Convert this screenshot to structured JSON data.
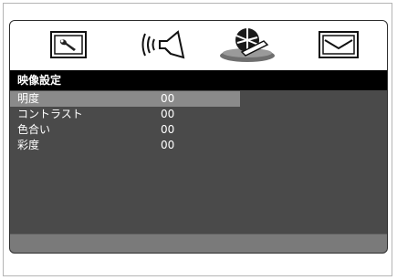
{
  "title": "映像設定",
  "tabs": [
    {
      "icon": "system-setup-icon"
    },
    {
      "icon": "audio-icon"
    },
    {
      "icon": "video-icon"
    },
    {
      "icon": "preferences-icon"
    }
  ],
  "items": [
    {
      "label": "明度",
      "value": "00"
    },
    {
      "label": "コントラスト",
      "value": "00"
    },
    {
      "label": "色合い",
      "value": "00"
    },
    {
      "label": "彩度",
      "value": "00"
    }
  ],
  "colors": {
    "osd_background": "#4a4a4a",
    "title_background": "#000000",
    "selected_row": "#8a8a8a",
    "status_bar": "#7a7a7a",
    "text": "#ffffff"
  }
}
